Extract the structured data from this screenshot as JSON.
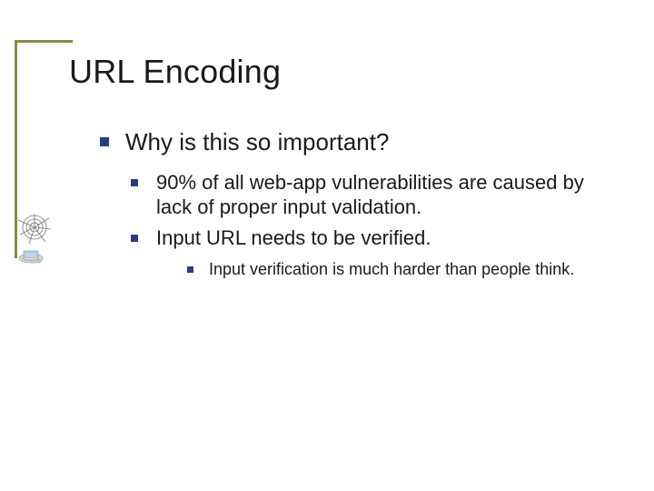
{
  "title": "URL Encoding",
  "bullets": {
    "lvl1": "Why is this so important?",
    "lvl2a": "90% of all web-app vulnerabilities are caused by lack of proper input validation.",
    "lvl2b": "Input URL needs to be verified.",
    "lvl3": "Input verification is much harder than people think."
  }
}
